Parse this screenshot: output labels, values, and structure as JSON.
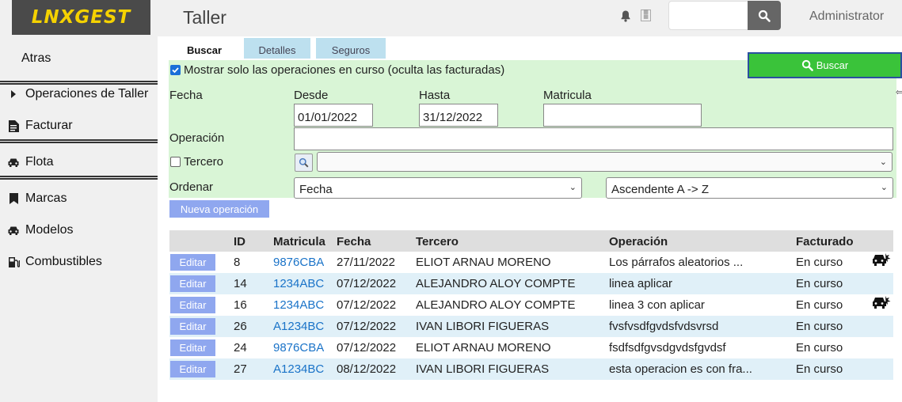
{
  "header": {
    "logo": "LNXGEST",
    "title": "Taller",
    "user": "Administrator"
  },
  "sidebar": {
    "back": "Atras",
    "items": [
      {
        "label": "Operaciones de Taller"
      },
      {
        "label": "Facturar"
      },
      {
        "label": "Flota"
      },
      {
        "label": "Marcas"
      },
      {
        "label": "Modelos"
      },
      {
        "label": "Combustibles"
      }
    ]
  },
  "tabs": [
    {
      "label": "Buscar",
      "active": true
    },
    {
      "label": "Detalles",
      "active": false
    },
    {
      "label": "Seguros",
      "active": false
    }
  ],
  "filter": {
    "only_current_label": "Mostrar solo las operaciones en curso (oculta las facturadas)",
    "only_current_checked": true,
    "fecha_label": "Fecha",
    "desde_label": "Desde",
    "desde_value": "01/01/2022",
    "hasta_label": "Hasta",
    "hasta_value": "31/12/2022",
    "matricula_label": "Matricula",
    "matricula_value": "",
    "operacion_label": "Operación",
    "operacion_value": "",
    "tercero_label": "Tercero",
    "tercero_checked": false,
    "tercero_value": "",
    "ordenar_label": "Ordenar",
    "ordenar_field": "Fecha",
    "ordenar_dir": "Ascendente A -> Z",
    "buscar_button": "Buscar",
    "new_button": "Nueva operación"
  },
  "table": {
    "headers": [
      "ID",
      "Matricula",
      "Fecha",
      "Tercero",
      "Operación",
      "Facturado"
    ],
    "edit_label": "Editar",
    "rows": [
      {
        "id": "8",
        "matricula": "9876CBA",
        "fecha": "27/11/2022",
        "tercero": "ELIOT ARNAU MORENO",
        "operacion": "Los párrafos aleatorios ...",
        "facturado": "En curso",
        "icon": true
      },
      {
        "id": "14",
        "matricula": "1234ABC",
        "fecha": "07/12/2022",
        "tercero": "ALEJANDRO ALOY COMPTE",
        "operacion": "linea aplicar",
        "facturado": "En curso",
        "icon": false
      },
      {
        "id": "16",
        "matricula": "1234ABC",
        "fecha": "07/12/2022",
        "tercero": "ALEJANDRO ALOY COMPTE",
        "operacion": "linea 3 con aplicar",
        "facturado": "En curso",
        "icon": true
      },
      {
        "id": "26",
        "matricula": "A1234BC",
        "fecha": "07/12/2022",
        "tercero": "IVAN LIBORI FIGUERAS",
        "operacion": "fvsfvsdfgvdsfvdsvrsd",
        "facturado": "En curso",
        "icon": false
      },
      {
        "id": "24",
        "matricula": "9876CBA",
        "fecha": "07/12/2022",
        "tercero": "ELIOT ARNAU MORENO",
        "operacion": "fsdfsdfgvsdgvdsfgvdsf",
        "facturado": "En curso",
        "icon": false
      },
      {
        "id": "27",
        "matricula": "A1234BC",
        "fecha": "08/12/2022",
        "tercero": "IVAN LIBORI FIGUERAS",
        "operacion": "esta operacion es con fra...",
        "facturado": "En curso",
        "icon": false
      }
    ]
  },
  "colors": {
    "filter_bg": "#d9f5d6",
    "buscar_green": "#3ac33a",
    "button_blue": "#8fa7ef",
    "link_blue": "#1a73c8",
    "logo_yellow": "#f5d200"
  }
}
